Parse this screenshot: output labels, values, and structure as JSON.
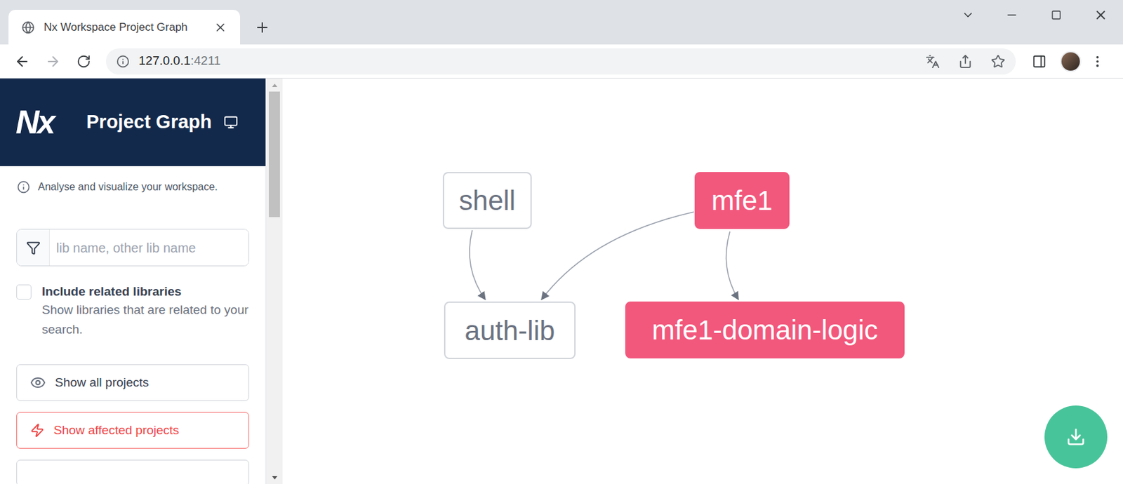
{
  "window": {
    "title": "Nx Workspace Project Graph"
  },
  "address_bar": {
    "host": "127.0.0.1",
    "port": ":4211"
  },
  "sidebar": {
    "logo": "Nx",
    "title": "Project Graph",
    "info": "Analyse and visualize your workspace.",
    "filter": {
      "placeholder": "lib name, other lib name"
    },
    "include_related": {
      "label": "Include related libraries",
      "description": "Show libraries that are related to your search.",
      "checked": false
    },
    "buttons": [
      {
        "label": "Show all projects",
        "kind": "eye"
      },
      {
        "label": "Show affected projects",
        "kind": "affected"
      }
    ]
  },
  "graph": {
    "nodes": [
      {
        "name": "shell",
        "affected": false
      },
      {
        "name": "mfe1",
        "affected": true
      },
      {
        "name": "auth-lib",
        "affected": false
      },
      {
        "name": "mfe1-domain-logic",
        "affected": true
      }
    ],
    "edges": [
      {
        "from": "shell",
        "to": "auth-lib"
      },
      {
        "from": "mfe1",
        "to": "auth-lib"
      },
      {
        "from": "mfe1",
        "to": "mfe1-domain-logic"
      }
    ]
  }
}
